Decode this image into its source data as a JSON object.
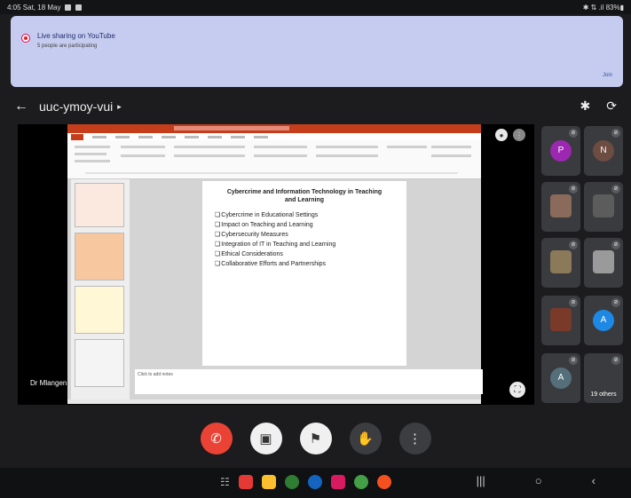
{
  "status_bar": {
    "time_date": "4:05 Sat, 18 May",
    "right_text": "✱ ⇅ .il 83%▮"
  },
  "notification": {
    "title": "Live sharing on YouTube",
    "subtitle": "5 people are participating",
    "action": "Join"
  },
  "top_bar": {
    "meeting_code": "uuc-ymoy-vui",
    "back_icon": "arrow-left-icon",
    "bluetooth_icon": "bluetooth-icon",
    "switch_camera_icon": "switch-camera-icon"
  },
  "presentation": {
    "presenter_name": "Dr Mlangen",
    "slide": {
      "title": "Cybercrime and Information Technology in Teaching and Learning",
      "bullets": [
        "Cybercrime in Educational Settings",
        "Impact on Teaching and Learning",
        "Cybersecurity Measures",
        "Integration of IT in Teaching and Learning",
        "Ethical Considerations",
        "Collaborative Efforts and Partnerships"
      ]
    },
    "notes_placeholder": "Click to add notes"
  },
  "participants": {
    "tiles": [
      {
        "type": "avatar",
        "initial": "P",
        "color": "#9c27b0"
      },
      {
        "type": "avatar",
        "initial": "N",
        "color": "#6d4c41"
      },
      {
        "type": "photo",
        "color": "#8a6a5a"
      },
      {
        "type": "photo",
        "color": "#5c5c5c"
      },
      {
        "type": "photo",
        "color": "#8a7a5a"
      },
      {
        "type": "photo",
        "color": "#9a9a9a"
      },
      {
        "type": "photo",
        "color": "#7a3a2a"
      },
      {
        "type": "avatar",
        "initial": "A",
        "color": "#1e88e5"
      },
      {
        "type": "avatar",
        "initial": "A",
        "color": "#546e7a"
      },
      {
        "type": "others",
        "label": "19 others"
      }
    ]
  },
  "controls": {
    "end_call_icon": "phone-end-icon",
    "camera_icon": "camera-off-icon",
    "mic_icon": "mic-off-icon",
    "hand_icon": "raise-hand-icon",
    "more_icon": "more-vert-icon"
  },
  "colors": {
    "end_call": "#ea4335",
    "notification_bg": "#c6ccef",
    "ppt_accent": "#c43e1c"
  }
}
